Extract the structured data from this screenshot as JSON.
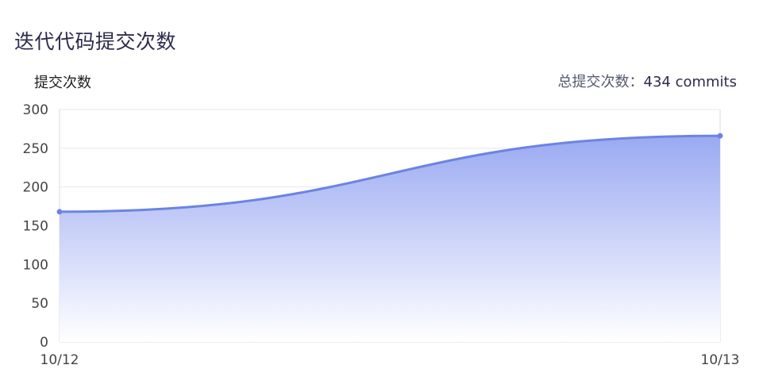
{
  "title": "迭代代码提交次数",
  "total": {
    "label": "总提交次数：",
    "value": "434 commits"
  },
  "colors": {
    "line": "#6b84e3",
    "area_top": "#9aa9f2",
    "area_bottom": "#ffffff",
    "grid": "#e6e8ef",
    "axis": "#d9dbe3"
  },
  "chart_data": {
    "type": "area",
    "title": "迭代代码提交次数",
    "ylabel": "提交次数",
    "xlabel": "",
    "categories": [
      "10/12",
      "10/13"
    ],
    "series": [
      {
        "values": [
          168,
          266
        ]
      }
    ],
    "ylim": [
      0,
      300
    ],
    "yticks": [
      0,
      50,
      100,
      150,
      200,
      250,
      300
    ],
    "smooth": true,
    "grid": true,
    "legend": "none"
  }
}
